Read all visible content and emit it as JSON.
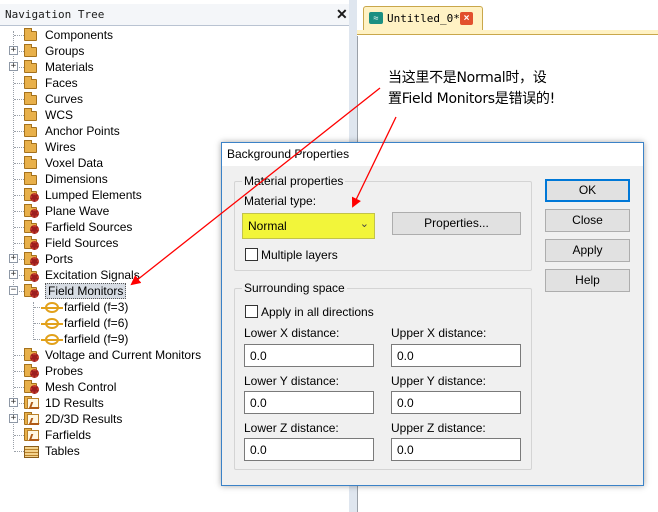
{
  "nav": {
    "title": "Navigation Tree",
    "close_glyph": "✕",
    "items": [
      {
        "label": "Components",
        "icon": "folder-icon",
        "expandable": false
      },
      {
        "label": "Groups",
        "icon": "folder-icon",
        "expandable": true
      },
      {
        "label": "Materials",
        "icon": "folder-icon",
        "expandable": true
      },
      {
        "label": "Faces",
        "icon": "folder-icon",
        "expandable": false
      },
      {
        "label": "Curves",
        "icon": "folder-icon",
        "expandable": false
      },
      {
        "label": "WCS",
        "icon": "folder-icon",
        "expandable": false
      },
      {
        "label": "Anchor Points",
        "icon": "folder-icon",
        "expandable": false
      },
      {
        "label": "Wires",
        "icon": "folder-icon",
        "expandable": false
      },
      {
        "label": "Voxel Data",
        "icon": "folder-icon",
        "expandable": false
      },
      {
        "label": "Dimensions",
        "icon": "folder-icon",
        "expandable": false
      },
      {
        "label": "Lumped Elements",
        "icon": "gear-folder-icon",
        "expandable": false
      },
      {
        "label": "Plane Wave",
        "icon": "gear-folder-icon",
        "expandable": false
      },
      {
        "label": "Farfield Sources",
        "icon": "gear-folder-icon",
        "expandable": false
      },
      {
        "label": "Field Sources",
        "icon": "gear-folder-icon",
        "expandable": false
      },
      {
        "label": "Ports",
        "icon": "gear-folder-icon",
        "expandable": true
      },
      {
        "label": "Excitation Signals",
        "icon": "gear-folder-icon",
        "expandable": true
      },
      {
        "label": "Field Monitors",
        "icon": "gear-folder-icon",
        "expandable": true,
        "expanded": true,
        "selected": true
      },
      {
        "label": "Voltage and Current Monitors",
        "icon": "gear-folder-icon",
        "expandable": false
      },
      {
        "label": "Probes",
        "icon": "gear-folder-icon",
        "expandable": false
      },
      {
        "label": "Mesh Control",
        "icon": "gear-folder-icon",
        "expandable": false
      },
      {
        "label": "1D Results",
        "icon": "plot-folder-icon",
        "expandable": true
      },
      {
        "label": "2D/3D Results",
        "icon": "plot-folder-icon",
        "expandable": true
      },
      {
        "label": "Farfields",
        "icon": "plot-folder-icon",
        "expandable": false
      },
      {
        "label": "Tables",
        "icon": "tables-icon",
        "expandable": false
      }
    ],
    "field_monitor_children": [
      {
        "label": "farfield (f=3)",
        "icon": "farfield-icon"
      },
      {
        "label": "farfield (f=6)",
        "icon": "farfield-icon"
      },
      {
        "label": "farfield (f=9)",
        "icon": "farfield-icon"
      }
    ]
  },
  "tab": {
    "label": "Untitled_0*",
    "icon": "cst-project-icon",
    "close_glyph": "×"
  },
  "annotation": {
    "line1": "当这里不是Normal时，设",
    "line2": "置Field Monitors是错误的!",
    "color": "#ff0000"
  },
  "dialog": {
    "title": "Background Properties",
    "material_group": {
      "legend": "Material properties",
      "type_label": "Material type:",
      "type_value": "Normal",
      "type_highlight": "#f2f53a",
      "properties_button": "Properties...",
      "multiple_layers_label": "Multiple layers",
      "multiple_layers_checked": false
    },
    "surrounding_group": {
      "legend": "Surrounding space",
      "apply_all_label": "Apply in all directions",
      "apply_all_checked": false,
      "lower_x_label": "Lower X distance:",
      "lower_x_value": "0.0",
      "upper_x_label": "Upper X distance:",
      "upper_x_value": "0.0",
      "lower_y_label": "Lower Y distance:",
      "lower_y_value": "0.0",
      "upper_y_label": "Upper Y distance:",
      "upper_y_value": "0.0",
      "lower_z_label": "Lower Z distance:",
      "lower_z_value": "0.0",
      "upper_z_label": "Upper Z distance:",
      "upper_z_value": "0.0"
    },
    "buttons": {
      "ok": "OK",
      "close": "Close",
      "apply": "Apply",
      "help": "Help"
    }
  }
}
